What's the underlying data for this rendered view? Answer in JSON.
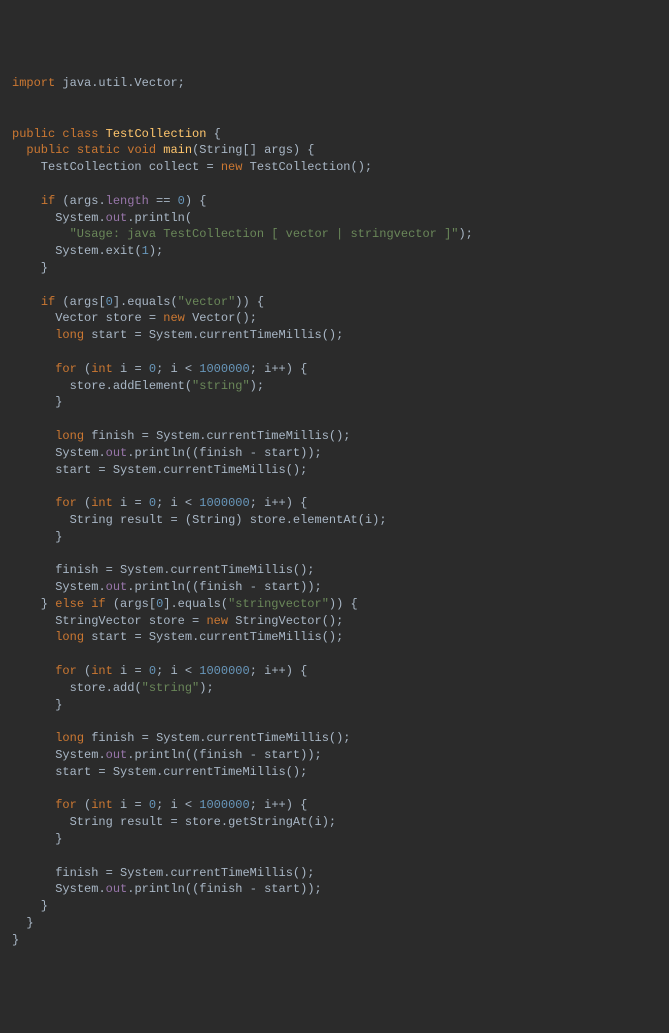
{
  "code": {
    "import_kw": "import",
    "import_pkg": " java.util.Vector;",
    "public_kw": "public",
    "class_kw": "class",
    "class_name": "TestCollection",
    "static_kw": "static",
    "void_kw": "void",
    "main_name": "main",
    "string_arr": "String[] args",
    "new_kw": "new",
    "testcollection_ctor": "TestCollection()",
    "collect_var": "collect",
    "if_kw": "if",
    "else_kw": "else",
    "args_var": "args",
    "length_field": "length",
    "eq_zero": "0",
    "system": "System",
    "out_field": "out",
    "println_m": "println",
    "usage_str": "\"Usage: java TestCollection [ vector | stringvector ]\"",
    "exit_m": "exit",
    "one": "1",
    "zero": "0",
    "equals_m": "equals",
    "vector_str": "\"vector\"",
    "stringvector_str": "\"stringvector\"",
    "vector_type": "Vector",
    "stringvector_type": "StringVector",
    "store_var": "store",
    "long_kw": "long",
    "start_var": "start",
    "finish_var": "finish",
    "currenttime_m": "currentTimeMillis",
    "for_kw": "for",
    "int_kw": "int",
    "i_var": "i",
    "million": "1000000",
    "addelement_m": "addElement",
    "add_m": "add",
    "string_str": "\"string\"",
    "string_type": "String",
    "result_var": "result",
    "elementat_m": "elementAt",
    "getstringat_m": "getStringAt"
  }
}
